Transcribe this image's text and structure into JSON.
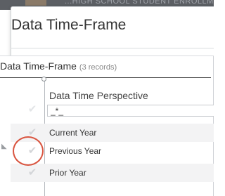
{
  "background": {
    "banner_text": "...HIGH SCHOOL STUDENT ENROLLMENT"
  },
  "dialog": {
    "title": "Data Time-Frame"
  },
  "card": {
    "title": "Data Time-Frame",
    "record_count": "(3 records)"
  },
  "table": {
    "column_header": "Data Time Perspective",
    "filter_value": "_*_",
    "rows": [
      {
        "label": "Current Year",
        "checked": false
      },
      {
        "label": "Previous Year",
        "checked": false,
        "highlighted": true
      },
      {
        "label": "Prior Year",
        "checked": false
      }
    ]
  },
  "icons": {
    "check": "checkmark-icon",
    "pointer": "arrow-pointer-icon"
  },
  "colors": {
    "highlight_ring": "#d9543f",
    "row_alt": "#f3f3f4",
    "check": "#d3d5d8"
  }
}
